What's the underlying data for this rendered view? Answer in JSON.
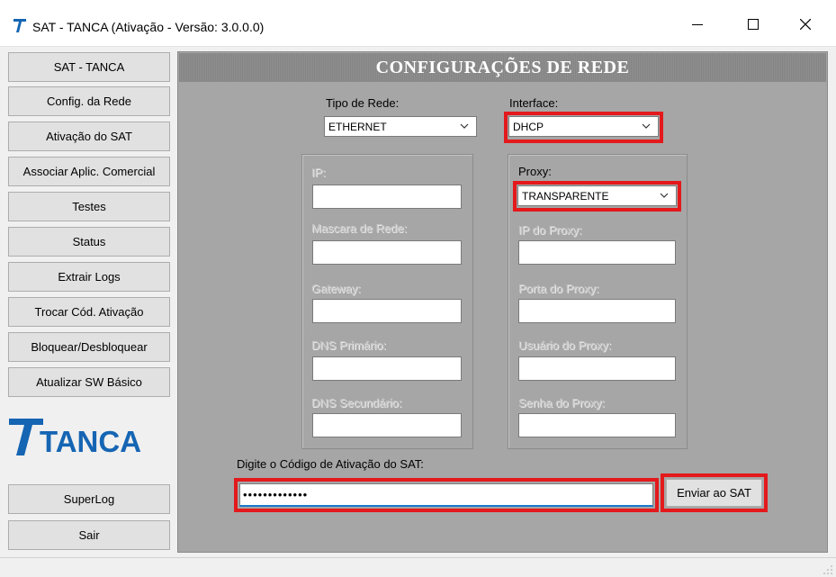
{
  "window": {
    "title": "SAT - TANCA (Ativação - Versão: 3.0.0.0)"
  },
  "sidebar": {
    "items": [
      {
        "label": "SAT - TANCA"
      },
      {
        "label": "Config. da Rede"
      },
      {
        "label": "Ativação do SAT"
      },
      {
        "label": "Associar Aplic. Comercial"
      },
      {
        "label": "Testes"
      },
      {
        "label": "Status"
      },
      {
        "label": "Extrair Logs"
      },
      {
        "label": "Trocar Cód. Ativação"
      },
      {
        "label": "Bloquear/Desbloquear"
      },
      {
        "label": "Atualizar SW Básico"
      }
    ],
    "logo_text": "TANCA",
    "superlog_label": "SuperLog",
    "sair_label": "Sair"
  },
  "panel": {
    "title": "CONFIGURAÇÕES DE REDE",
    "tipo_rede": {
      "label": "Tipo de Rede:",
      "value": "ETHERNET"
    },
    "interface": {
      "label": "Interface:",
      "value": "DHCP"
    },
    "network": {
      "ip_label": "IP:",
      "mask_label": "Mascara de Rede:",
      "gateway_label": "Gateway:",
      "dns1_label": "DNS Primário:",
      "dns2_label": "DNS Secundário:"
    },
    "proxy": {
      "label": "Proxy:",
      "value": "TRANSPARENTE",
      "ip_label": "IP do Proxy:",
      "port_label": "Porta do Proxy:",
      "user_label": "Usuário do Proxy:",
      "pass_label": "Senha do Proxy:"
    },
    "activation": {
      "label": "Digite o Código de Ativação do SAT:",
      "value": "•••••••••••••",
      "send_label": "Enviar ao SAT"
    }
  },
  "colors": {
    "highlight": "#e3191c",
    "brand_blue": "#1565b3",
    "panel_bg": "#a6a6a6"
  }
}
